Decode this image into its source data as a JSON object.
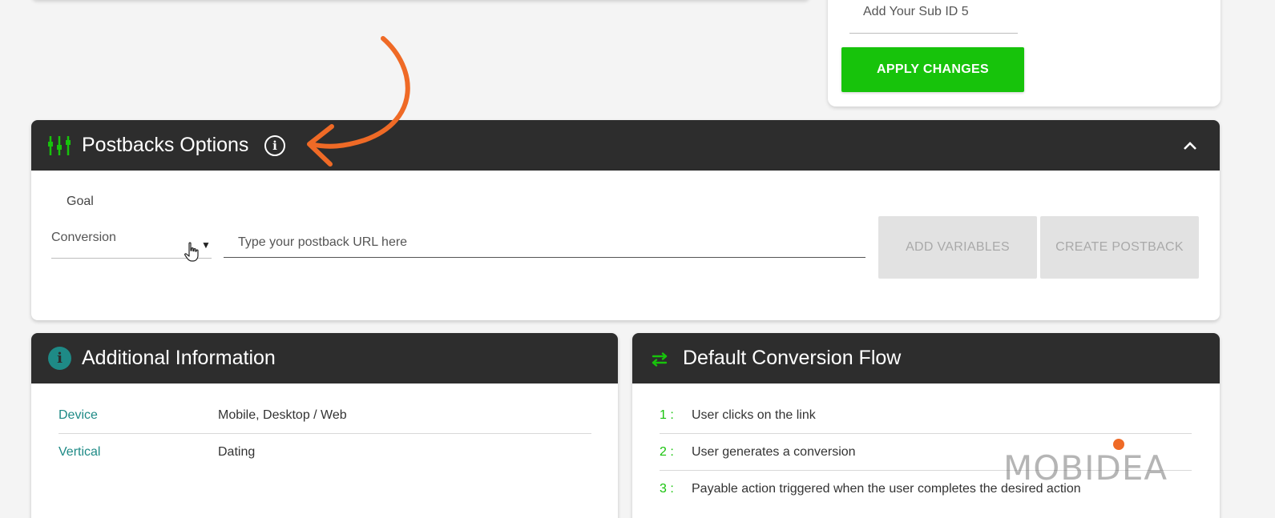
{
  "subid": {
    "placeholder": "Add Your Sub ID 5",
    "apply_label": "APPLY CHANGES"
  },
  "postbacks": {
    "title": "Postbacks Options",
    "info_glyph": "i",
    "goal_label": "Goal",
    "goal_value": "Conversion",
    "url_placeholder": "Type your postback URL here",
    "add_variables_label": "ADD VARIABLES",
    "create_postback_label": "CREATE POSTBACK"
  },
  "additional_info": {
    "title": "Additional Information",
    "rows": [
      {
        "key": "Device",
        "value": "Mobile, Desktop / Web"
      },
      {
        "key": "Vertical",
        "value": "Dating"
      }
    ]
  },
  "conversion_flow": {
    "title": "Default Conversion Flow",
    "steps": [
      {
        "num": "1 :",
        "text": "User clicks on the link"
      },
      {
        "num": "2 :",
        "text": "User generates a conversion"
      },
      {
        "num": "3 :",
        "text": "Payable action triggered when the user completes the desired action"
      }
    ]
  },
  "watermark": "MOBIDEA",
  "colors": {
    "accent_green": "#17c30b",
    "header_dark": "#2d2d2d",
    "teal": "#1e8a86",
    "annotation_orange": "#ef6a26"
  },
  "icons": [
    "postback-icon",
    "info-icon",
    "chevron-up-icon",
    "info-badge-icon",
    "swap-arrows-icon",
    "hand-cursor-icon",
    "curved-arrow-annotation"
  ]
}
